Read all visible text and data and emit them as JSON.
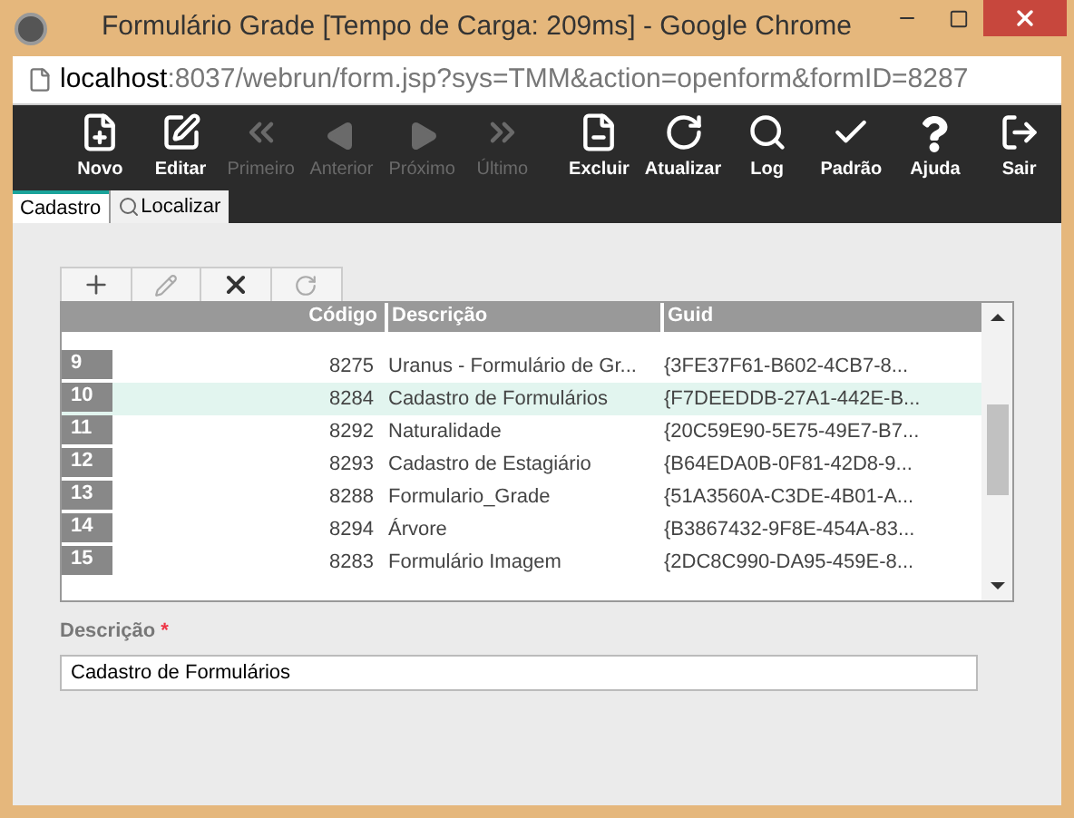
{
  "window": {
    "title": "Formulário Grade [Tempo de Carga: 209ms] - Google Chrome"
  },
  "address_bar": {
    "host": "localhost",
    "path": ":8037/webrun/form.jsp?sys=TMM&action=openform&formID=8287"
  },
  "toolbar": [
    {
      "label": "Novo",
      "disabled": false
    },
    {
      "label": "Editar",
      "disabled": false
    },
    {
      "label": "Primeiro",
      "disabled": true
    },
    {
      "label": "Anterior",
      "disabled": true
    },
    {
      "label": "Próximo",
      "disabled": true
    },
    {
      "label": "Último",
      "disabled": true
    },
    {
      "label": "Excluir",
      "disabled": false
    },
    {
      "label": "Atualizar",
      "disabled": false
    },
    {
      "label": "Log",
      "disabled": false
    },
    {
      "label": "Padrão",
      "disabled": false
    },
    {
      "label": "Ajuda",
      "disabled": false
    },
    {
      "label": "Sair",
      "disabled": false
    }
  ],
  "tabs": [
    {
      "label": "Cadastro",
      "selected": true
    },
    {
      "label": "Localizar",
      "selected": false
    }
  ],
  "grid": {
    "columns": [
      "Código",
      "Descrição",
      "Guid"
    ],
    "rows": [
      {
        "number": "9",
        "code": "8275",
        "description": "Uranus - Formulário de Gr...",
        "guid": "{3FE37F61-B602-4CB7-8...",
        "selected": false
      },
      {
        "number": "10",
        "code": "8284",
        "description": "Cadastro de Formulários",
        "guid": "{F7DEEDDB-27A1-442E-B...",
        "selected": true
      },
      {
        "number": "11",
        "code": "8292",
        "description": "Naturalidade",
        "guid": "{20C59E90-5E75-49E7-B7...",
        "selected": false
      },
      {
        "number": "12",
        "code": "8293",
        "description": "Cadastro de Estagiário",
        "guid": "{B64EDA0B-0F81-42D8-9...",
        "selected": false
      },
      {
        "number": "13",
        "code": "8288",
        "description": "Formulario_Grade",
        "guid": "{51A3560A-C3DE-4B01-A...",
        "selected": false
      },
      {
        "number": "14",
        "code": "8294",
        "description": "Árvore",
        "guid": "{B3867432-9F8E-454A-83...",
        "selected": false
      },
      {
        "number": "15",
        "code": "8283",
        "description": "Formulário Imagem",
        "guid": "{2DC8C990-DA95-459E-8...",
        "selected": false
      }
    ]
  },
  "field": {
    "label": "Descrição",
    "required_mark": "*",
    "value": "Cadastro de Formulários"
  }
}
